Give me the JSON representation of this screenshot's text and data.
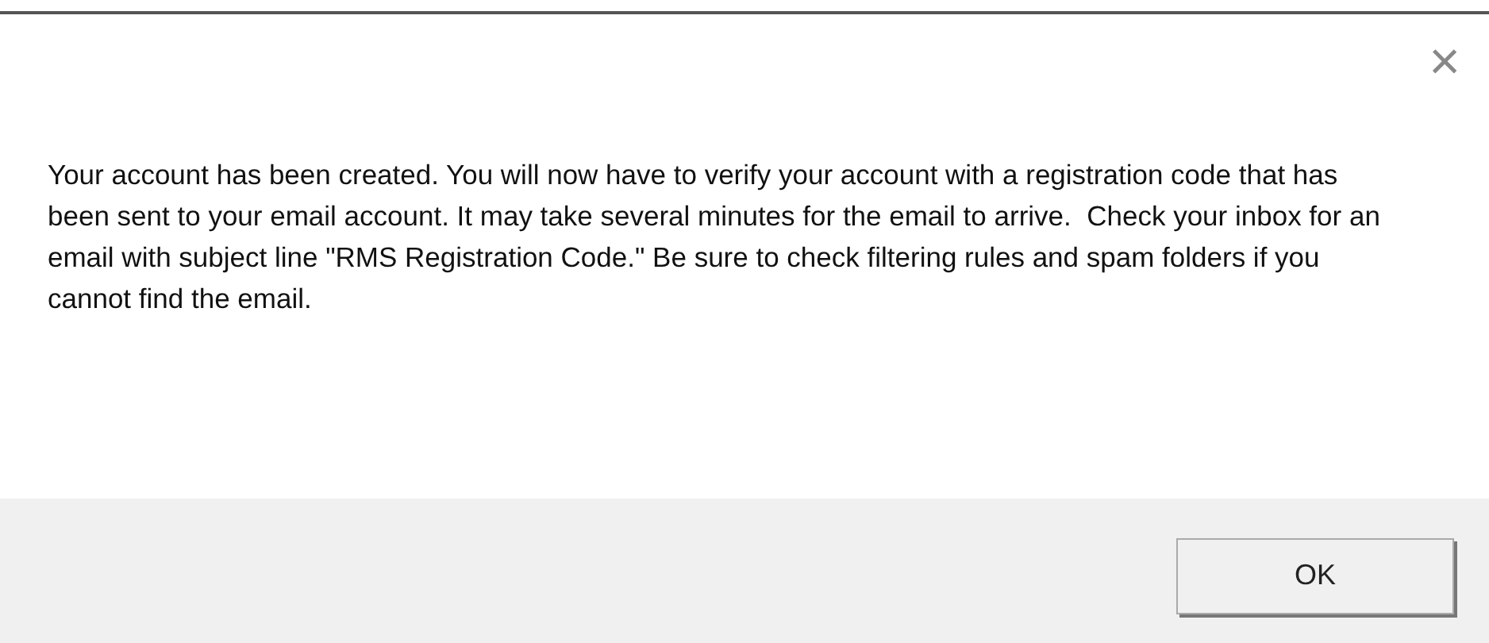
{
  "dialog": {
    "close_button": "×",
    "message": "Your account has been created. You will now have to verify your account with a registration code that has been sent to your email account. It may take several minutes for the email to arrive.  Check your inbox for an email with subject line \"RMS Registration Code.\" Be sure to check filtering rules and spam folders if you cannot find the email.",
    "buttons": [
      "OK"
    ]
  }
}
